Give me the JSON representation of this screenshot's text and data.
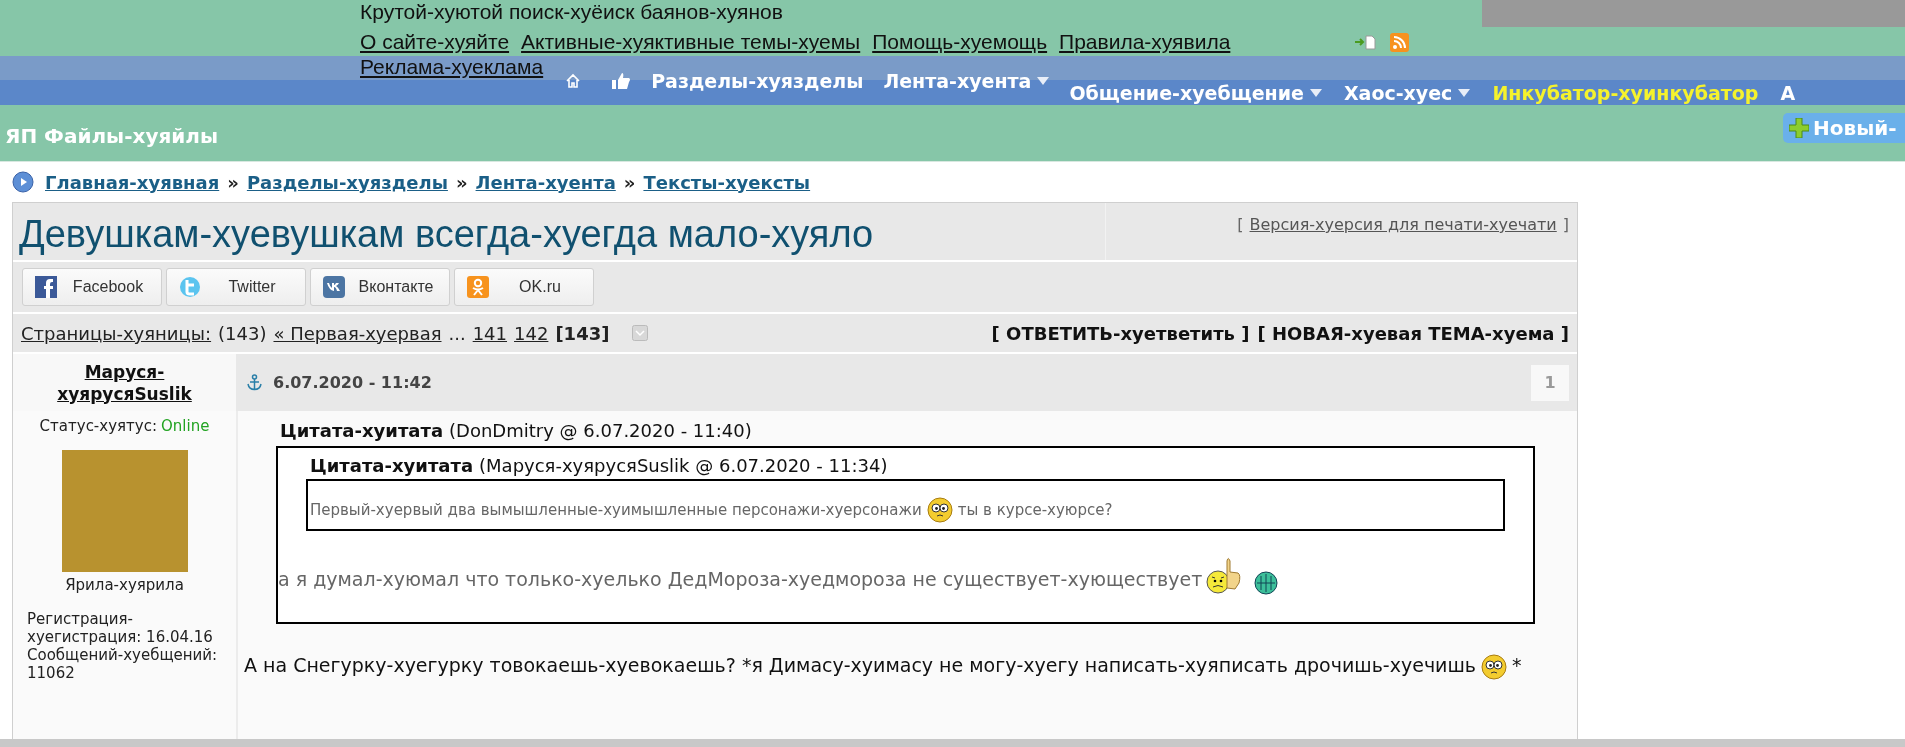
{
  "header": {
    "tagline": "Крутой-хуютой поиск-хуёиск баянов-хуянов",
    "links": [
      "О сайте-хуяйте",
      "Активные-хуяктивные темы-хуемы",
      "Помощь-хуемощь",
      "Правила-хуявила"
    ],
    "links_2": [
      "Реклама-хуеклама"
    ],
    "nav_1": [
      {
        "label": "Разделы-хуязделы",
        "dropdown": false,
        "highlighted": false
      },
      {
        "label": "Лента-хуента",
        "dropdown": true,
        "highlighted": false
      }
    ],
    "nav_2": [
      {
        "label": "Общение-хуебщение",
        "dropdown": true,
        "highlighted": false
      },
      {
        "label": "Хаос-хуес",
        "dropdown": true,
        "highlighted": false
      },
      {
        "label": "Инкубатор-хуинкубатор",
        "dropdown": false,
        "highlighted": true
      },
      {
        "label": "А",
        "dropdown": false,
        "highlighted": false
      }
    ],
    "section_title": "ЯП Файлы-хуяйлы",
    "new_button": "Новый-"
  },
  "breadcrumb": [
    "Главная-хуявная",
    "Разделы-хуязделы",
    "Лента-хуента",
    "Тексты-хуексты"
  ],
  "breadcrumb_separator": "»",
  "topic": {
    "title": "Девушкам-хуевушкам всегда-хуегда мало-хуяло",
    "print_link": "Версия-хуерсия для печати-хуечати",
    "bracket_open": "[",
    "bracket_close": "]"
  },
  "share_buttons": [
    {
      "kind": "facebook",
      "label": "Facebook"
    },
    {
      "kind": "twitter",
      "label": "Twitter"
    },
    {
      "kind": "vk",
      "label": "Вконтакте"
    },
    {
      "kind": "ok",
      "label": "OK.ru"
    }
  ],
  "pages": {
    "label": "Страницы-хуяницы:",
    "count": "(143)",
    "first": "« Первая-хуервая",
    "ellipsis": "...",
    "items": [
      {
        "label": "141",
        "selected": false
      },
      {
        "label": "142",
        "selected": false
      },
      {
        "label": "[143]",
        "selected": true
      }
    ]
  },
  "actions": [
    "[ ОТВЕТИТЬ-хуетветить ]",
    "[ НОВАЯ-хуевая ТЕМА-хуема ]"
  ],
  "post": {
    "author": "Маруся-хуярусяSuslik",
    "date": "6.07.2020 - 11:42",
    "number": "1",
    "status_label": "Статус-хуятус:",
    "status": "Online",
    "rank": "Ярила-хуярила",
    "registration": "Регистрация-хуегистрация: 16.04.16",
    "posts_count": "Сообщений-хуебщений: 11062",
    "quote": {
      "title": "Цитата-хуитата",
      "meta": "(DonDmitry @ 6.07.2020 - 11:40)",
      "inner": {
        "title": "Цитата-хуитата",
        "meta": "(Маруся-хуярусяSuslik @ 6.07.2020 - 11:34)",
        "content": [
          {
            "kind": "text",
            "text": "Первый-хуервый два вымышленные-хуимышленные персонажи-хуерсонажи"
          },
          {
            "kind": "emoticon"
          },
          {
            "kind": "text",
            "text": "ты в курсе-хуюрсе?"
          }
        ]
      },
      "content": [
        {
          "kind": "text",
          "text": "а я думал-хуюмал что только-хуелько ДедМороза-хуедмороза не существует-хующествует"
        },
        {
          "kind": "pointing"
        },
        {
          "kind": "globe"
        }
      ]
    },
    "content": [
      {
        "kind": "text",
        "text": "А на Снегурку-хуегурку товокаешь-хуевокаешь? *я Димасу-хуимасу не могу-хуегу написать-хуяписать дрочишь-хуечишь"
      },
      {
        "kind": "emoticon"
      },
      {
        "kind": "text",
        "text": "*"
      }
    ]
  }
}
